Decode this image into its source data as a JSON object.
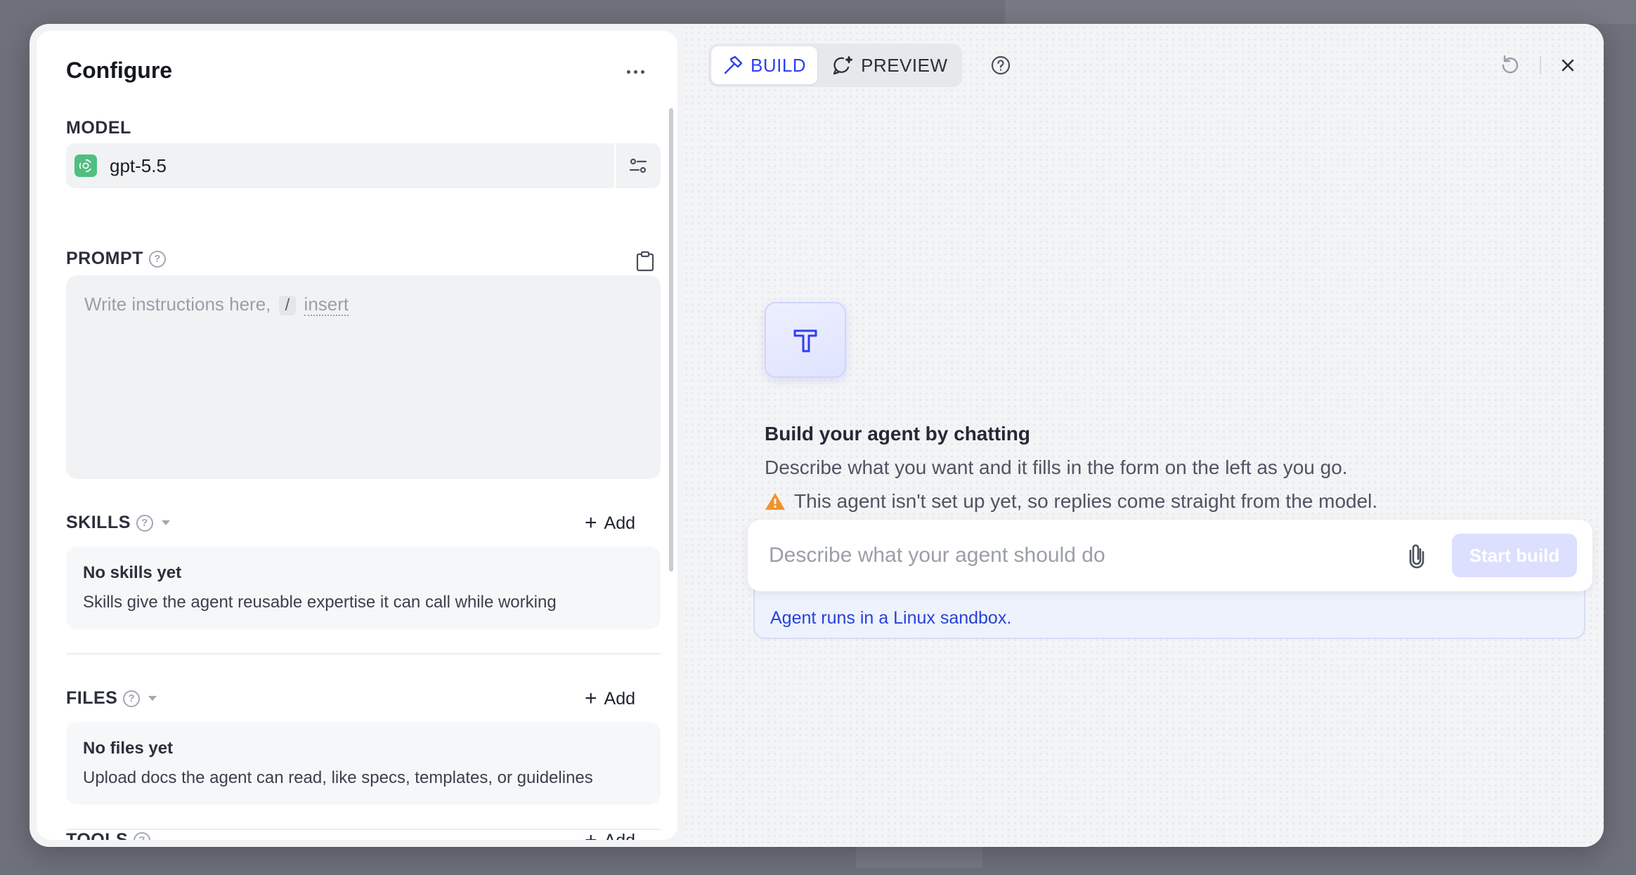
{
  "left_panel": {
    "title": "Configure",
    "model": {
      "label": "MODEL",
      "name": "gpt-5.5"
    },
    "prompt": {
      "label": "PROMPT",
      "placeholder_text": "Write instructions here,",
      "slash_key": "/",
      "insert_text": "insert"
    },
    "skills": {
      "label": "SKILLS",
      "add_label": "Add",
      "empty_title": "No skills yet",
      "empty_desc": "Skills give the agent reusable expertise it can call while working"
    },
    "files": {
      "label": "FILES",
      "add_label": "Add",
      "empty_title": "No files yet",
      "empty_desc": "Upload docs the agent can read, like specs, templates, or guidelines"
    },
    "tools": {
      "label": "TOOLS",
      "add_label": "Add"
    }
  },
  "right_panel": {
    "tabs": [
      {
        "label": "BUILD",
        "active": true
      },
      {
        "label": "PREVIEW",
        "active": false
      }
    ],
    "hero": {
      "title": "Build your agent by chatting",
      "description": "Describe what you want and it fills in the form on the left as you go.",
      "warning": "This agent isn't set up yet, so replies come straight from the model."
    },
    "chat": {
      "placeholder": "Describe what your agent should do",
      "value": "",
      "submit_label": "Start build"
    },
    "sandbox_note": "Agent runs in a Linux sandbox."
  },
  "icons": {
    "more": "more-horizontal-icon",
    "model_logo": "openai-logo-icon",
    "model_settings": "sliders-icon",
    "clipboard": "clipboard-icon",
    "help": "help-circle-icon",
    "build": "hammer-icon",
    "preview": "sparkle-chat-icon",
    "reload": "reload-icon",
    "close": "close-icon",
    "hero": "hammer-icon",
    "warning": "warning-icon",
    "attach": "paperclip-icon"
  },
  "colors": {
    "accent": "#2f3ff0",
    "warning": "#f0932b",
    "model_logo": "#4fbf7f",
    "start_button_disabled": "#dcdffd"
  }
}
